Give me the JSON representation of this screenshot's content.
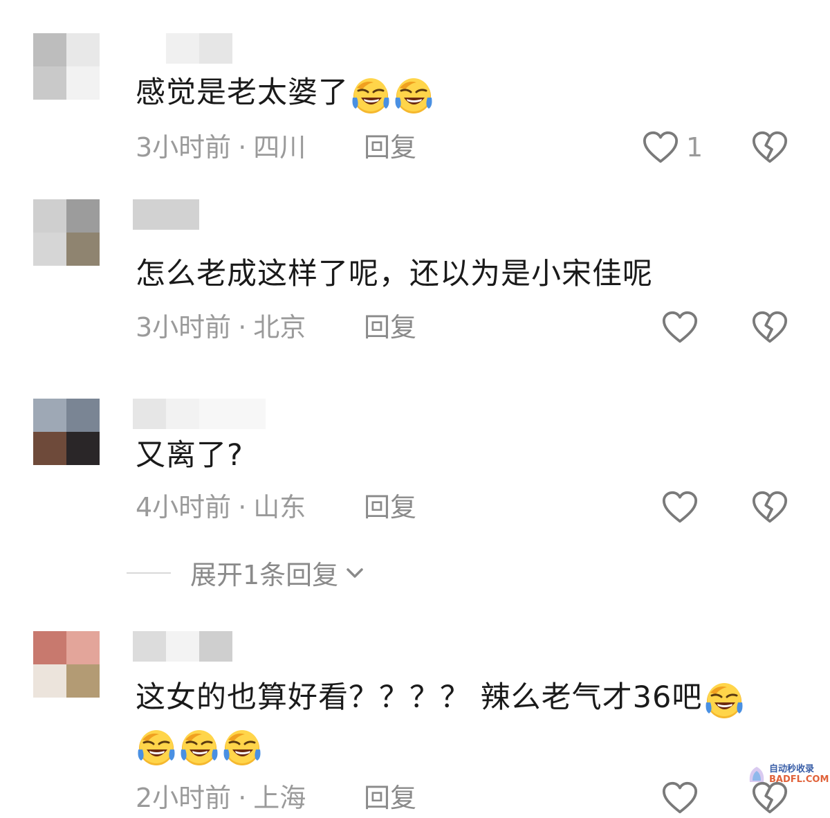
{
  "comments": [
    {
      "text": "感觉是老太婆了",
      "time": "3小时前",
      "location": "四川",
      "reply_label": "回复",
      "like_count": "1",
      "emoji_inline": [
        "laugh-cry-emoji",
        "laugh-cry-emoji"
      ]
    },
    {
      "text": "怎么老成这样了呢，还以为是小宋佳呢",
      "time": "3小时前",
      "location": "北京",
      "reply_label": "回复",
      "like_count": ""
    },
    {
      "text": "又离了?",
      "time": "4小时前",
      "location": "山东",
      "reply_label": "回复",
      "like_count": ""
    },
    {
      "text": "这女的也算好看？？？？ 辣么老气才36吧",
      "time": "2小时前",
      "location": "上海",
      "reply_label": "回复",
      "like_count": "",
      "emoji_inline": [
        "laugh-cry-emoji"
      ],
      "emoji_next_line": [
        "laugh-cry-emoji",
        "laugh-cry-emoji",
        "laugh-cry-emoji"
      ]
    }
  ],
  "expand_replies": {
    "label": "展开1条回复"
  },
  "separator": "·",
  "watermark": {
    "line1": "自动秒收录",
    "line2": "BADFL.COM"
  },
  "colors": {
    "text": "#1a1a1a",
    "meta": "#9a9a9a",
    "emoji_face": "#f5b82e",
    "emoji_tear": "#4a90e2"
  },
  "icons": {
    "like": "heart-outline-icon",
    "dislike": "broken-heart-icon",
    "expand": "chevron-down-icon"
  }
}
